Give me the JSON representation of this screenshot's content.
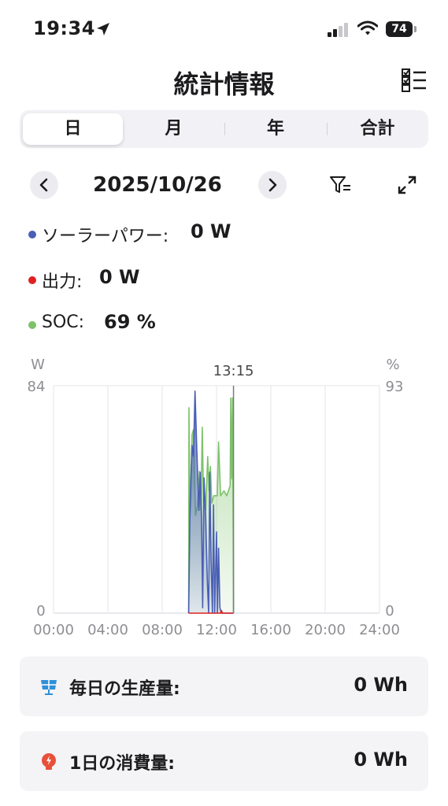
{
  "status_bar": {
    "time": "19:34",
    "battery": "74"
  },
  "title": "統計情報",
  "tabs": [
    {
      "label": "日",
      "active": true
    },
    {
      "label": "月",
      "active": false
    },
    {
      "label": "年",
      "active": false
    },
    {
      "label": "合計",
      "active": false
    }
  ],
  "date_nav": {
    "date": "2025/10/26"
  },
  "legend": [
    {
      "name": "ソーラーパワー:",
      "value": "0 W",
      "color": "#4a5fb5"
    },
    {
      "name": "出力:",
      "value": "0 W",
      "color": "#e02020"
    },
    {
      "name": "SOC:",
      "value": "69 %",
      "color": "#7cc26a"
    }
  ],
  "chart_data": {
    "type": "area",
    "left_axis": {
      "unit": "W",
      "max_label": "84",
      "min_label": "0",
      "range": [
        0,
        84
      ]
    },
    "right_axis": {
      "unit": "%",
      "max_label": "93",
      "min_label": "0",
      "range": [
        0,
        93
      ]
    },
    "cursor_label": "13:15",
    "x_ticks": [
      "00:00",
      "04:00",
      "08:00",
      "12:00",
      "16:00",
      "20:00",
      "24:00"
    ],
    "x_range_hours": [
      0,
      24
    ],
    "grid": true,
    "series": [
      {
        "name": "ソーラーパワー",
        "axis": "left",
        "color": "#4a5fb5",
        "points": [
          [
            9.95,
            0
          ],
          [
            10.05,
            40
          ],
          [
            10.2,
            62
          ],
          [
            10.3,
            58
          ],
          [
            10.42,
            82
          ],
          [
            10.55,
            60
          ],
          [
            10.7,
            38
          ],
          [
            10.8,
            52
          ],
          [
            10.9,
            35
          ],
          [
            10.98,
            2
          ],
          [
            11.08,
            50
          ],
          [
            11.2,
            36
          ],
          [
            11.32,
            12
          ],
          [
            11.42,
            0
          ],
          [
            11.5,
            52
          ],
          [
            11.6,
            20
          ],
          [
            11.7,
            0
          ],
          [
            11.78,
            40
          ],
          [
            11.86,
            0
          ],
          [
            12.0,
            30
          ],
          [
            12.07,
            0
          ],
          [
            12.15,
            24
          ],
          [
            12.25,
            2
          ],
          [
            12.35,
            0
          ],
          [
            13.25,
            0
          ]
        ]
      },
      {
        "name": "出力",
        "axis": "left",
        "color": "#e02020",
        "points": [
          [
            9.95,
            0
          ],
          [
            12.3,
            0
          ],
          [
            12.35,
            1
          ],
          [
            12.45,
            0
          ],
          [
            13.25,
            0
          ]
        ]
      },
      {
        "name": "SOC",
        "axis": "right",
        "color": "#7cc26a",
        "points": [
          [
            9.95,
            0
          ],
          [
            9.97,
            84
          ],
          [
            10.05,
            40
          ],
          [
            10.1,
            45
          ],
          [
            10.2,
            73
          ],
          [
            10.3,
            75
          ],
          [
            10.45,
            40
          ],
          [
            10.6,
            44
          ],
          [
            10.75,
            58
          ],
          [
            10.85,
            42
          ],
          [
            10.95,
            76
          ],
          [
            11.05,
            45
          ],
          [
            11.2,
            42
          ],
          [
            11.35,
            64
          ],
          [
            11.45,
            50
          ],
          [
            11.55,
            60
          ],
          [
            11.65,
            45
          ],
          [
            11.8,
            48
          ],
          [
            12.05,
            48
          ],
          [
            12.15,
            70
          ],
          [
            12.3,
            48
          ],
          [
            12.55,
            50
          ],
          [
            12.75,
            48
          ],
          [
            13.0,
            52
          ],
          [
            13.05,
            88
          ],
          [
            13.12,
            55
          ],
          [
            13.18,
            88
          ],
          [
            13.25,
            0
          ]
        ]
      }
    ]
  },
  "cards": [
    {
      "label": "毎日の生産量:",
      "value": "0 Wh",
      "icon": "solar-panel-icon"
    },
    {
      "label": "1日の消費量:",
      "value": "0 Wh",
      "icon": "lightbulb-icon"
    }
  ]
}
